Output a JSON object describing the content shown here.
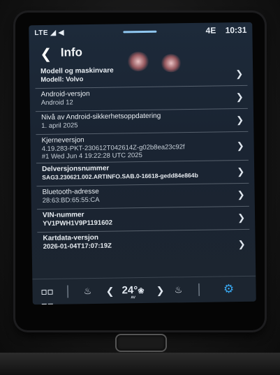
{
  "status": {
    "left": "LTE ◢ ◀",
    "network": "4E",
    "time": "10:31"
  },
  "header": {
    "title": "Info"
  },
  "rows": [
    {
      "title": "Modell og maskinvare",
      "value": "Modell: Volvo"
    },
    {
      "title": "Android-versjon",
      "value": "Android 12"
    },
    {
      "title": "Nivå av Android-sikkerhetsoppdatering",
      "value": "1. april 2025"
    },
    {
      "title": "Kjerneversjon",
      "value": "4.19.283-PKT-230612T042614Z-g02b8ea23c92f",
      "value2": "#1 Wed Jun 4 19:22:28 UTC 2025"
    },
    {
      "title": "Delversjonsnummer",
      "value": "SAG3.230621.002.ARTINFO.SAB.0-16618-gedd84e864b"
    },
    {
      "title": "Bluetooth-adresse",
      "value": "28:63:BD:65:55:CA"
    },
    {
      "title": "VIN-nummer",
      "value": "YV1PWH1V9P1191602"
    },
    {
      "title": "Kartdata-versjon",
      "value": "2026-01-04T17:07:19Z"
    }
  ],
  "bottombar": {
    "temp_value": "24°",
    "temp_unit": "AV"
  },
  "icons": {
    "back": "chevron-left-icon",
    "row_chevron": "chevron-right-icon",
    "apps": "grid-icon",
    "seat": "seat-heat-icon",
    "settings": "gear-icon"
  },
  "colors": {
    "accent": "#39a7ef",
    "screen_bg": "#1c2633",
    "text": "#e9eef3"
  }
}
